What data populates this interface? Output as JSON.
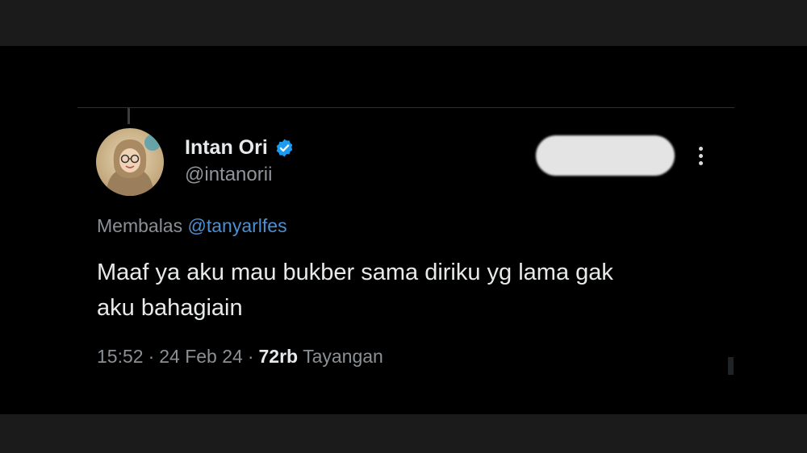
{
  "tweet": {
    "author": {
      "display_name": "Intan Ori",
      "handle": "@intanorii",
      "verified": true,
      "avatar_icon": "profile-photo-avatar"
    },
    "follow_button_label": "",
    "more_icon": "more-vertical-icon",
    "reply_context": {
      "prefix": "Membalas",
      "mention": "@tanyarlfes"
    },
    "text": "Maaf ya aku mau bukber sama diriku yg lama gak\naku bahagiain",
    "meta": {
      "time": "15:52",
      "separator_1": "·",
      "date": "24 Feb 24",
      "separator_2": "·",
      "views_count": "72rb",
      "views_label": "Tayangan"
    }
  },
  "colors": {
    "background": "#000000",
    "text_primary": "#e7e9ea",
    "text_secondary": "#8b9095",
    "link": "#4d8fcf",
    "verified_badge": "#1d9bf0"
  }
}
